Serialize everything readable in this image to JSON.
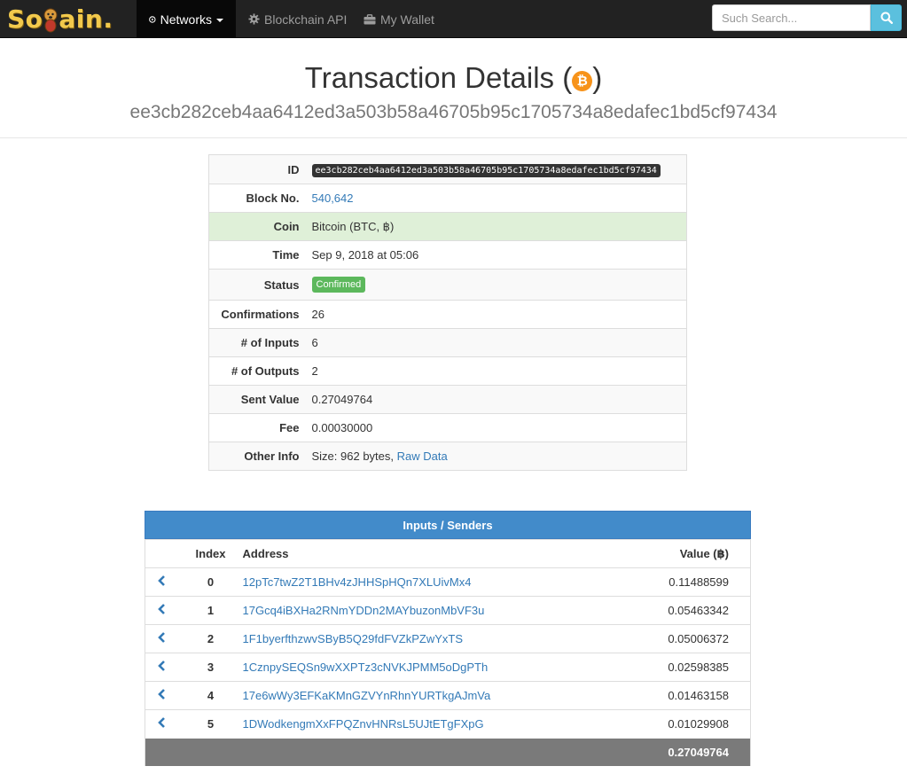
{
  "nav": {
    "logo_text": "SoChain.",
    "items": [
      {
        "label": "Networks",
        "icon": "play-circle-icon"
      },
      {
        "label": "Blockchain API",
        "icon": "gear-icon"
      },
      {
        "label": "My Wallet",
        "icon": "briefcase-icon"
      }
    ],
    "search_placeholder": "Such Search...",
    "search_icon": "search-icon"
  },
  "header": {
    "title": "Transaction Details (",
    "title_close": ")",
    "coin_symbol": "₿",
    "hash": "ee3cb282ceb4aa6412ed3a503b58a46705b95c1705734a8edafec1bd5cf97434"
  },
  "details": [
    {
      "key": "ID",
      "value": "ee3cb282ceb4aa6412ed3a503b58a46705b95c1705734a8edafec1bd5cf97434"
    },
    {
      "key": "Block No.",
      "value": "540,642"
    },
    {
      "key": "Coin",
      "value": "Bitcoin (BTC, ฿)"
    },
    {
      "key": "Time",
      "value": "Sep 9, 2018 at 05:06"
    },
    {
      "key": "Status",
      "value": "Confirmed"
    },
    {
      "key": "Confirmations",
      "value": "26"
    },
    {
      "key": "# of Inputs",
      "value": "6"
    },
    {
      "key": "# of Outputs",
      "value": "2"
    },
    {
      "key": "Sent Value",
      "value": "0.27049764"
    },
    {
      "key": "Fee",
      "value": "0.00030000"
    },
    {
      "key": "Other Info",
      "value": "Size: 962 bytes, ",
      "link": "Raw Data"
    }
  ],
  "inputs": {
    "title": "Inputs / Senders",
    "headers": {
      "index": "Index",
      "address": "Address",
      "value": "Value (฿)"
    },
    "rows": [
      {
        "index": "0",
        "address": "12pTc7twZ2T1BHv4zJHHSpHQn7XLUivMx4",
        "value": "0.11488599"
      },
      {
        "index": "1",
        "address": "17Gcq4iBXHa2RNmYDDn2MAYbuzonMbVF3u",
        "value": "0.05463342"
      },
      {
        "index": "2",
        "address": "1F1byerfthzwvSByB5Q29fdFVZkPZwYxTS",
        "value": "0.05006372"
      },
      {
        "index": "3",
        "address": "1CznpySEQSn9wXXPTz3cNVKJPMM5oDgPTh",
        "value": "0.02598385"
      },
      {
        "index": "4",
        "address": "17e6wWy3EFKaKMnGZVYnRhnYURTkgAJmVa",
        "value": "0.01463158"
      },
      {
        "index": "5",
        "address": "1DWodkengmXxFPQZnvHNRsL5UJtETgFXpG",
        "value": "0.01029908"
      }
    ],
    "total": "0.27049764"
  },
  "colors": {
    "nav_bg": "#222222",
    "primary": "#428bca",
    "link": "#337ab7",
    "success": "#5cb85c",
    "bitcoin": "#f7931a"
  }
}
